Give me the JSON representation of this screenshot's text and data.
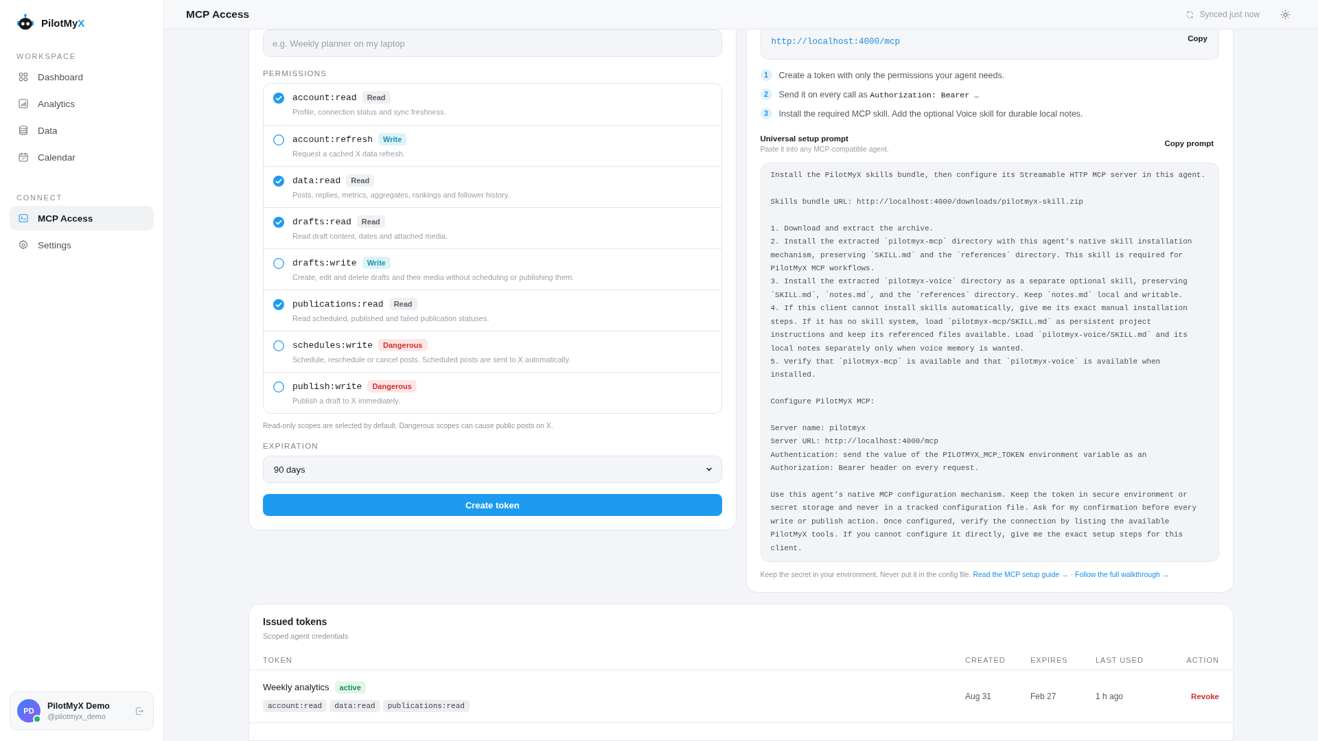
{
  "sidebar": {
    "brand": {
      "name": "PilotMy",
      "accent": "X"
    },
    "sections": [
      {
        "heading": "WORKSPACE",
        "items": [
          {
            "label": "Dashboard",
            "kind": "grid",
            "selected": false
          },
          {
            "label": "Analytics",
            "kind": "chart",
            "selected": false
          },
          {
            "label": "Data",
            "kind": "database",
            "selected": false
          },
          {
            "label": "Calendar",
            "kind": "calendar",
            "selected": false
          }
        ]
      },
      {
        "heading": "CONNECT",
        "items": [
          {
            "label": "MCP Access",
            "kind": "terminal",
            "selected": true
          },
          {
            "label": "Settings",
            "kind": "gear",
            "selected": false
          }
        ]
      }
    ],
    "user": {
      "initials": "PD",
      "name": "PilotMyX Demo",
      "handle": "@pilotmyx_demo",
      "online": true
    }
  },
  "header": {
    "title": "MCP Access",
    "sync_status": "Synced just now"
  },
  "token_form": {
    "name_field": {
      "placeholder": "e.g. Weekly planner on my laptop"
    },
    "permissions_heading": "PERMISSIONS",
    "permissions": [
      {
        "scope": "account:read",
        "badge": "Read",
        "kind": "read",
        "description": "Profile, connection status and sync freshness.",
        "checked": true
      },
      {
        "scope": "account:refresh",
        "badge": "Write",
        "kind": "write",
        "description": "Request a cached X data refresh.",
        "checked": false
      },
      {
        "scope": "data:read",
        "badge": "Read",
        "kind": "read",
        "description": "Posts, replies, metrics, aggregates, rankings and follower history.",
        "checked": true
      },
      {
        "scope": "drafts:read",
        "badge": "Read",
        "kind": "read",
        "description": "Read draft content, dates and attached media.",
        "checked": true
      },
      {
        "scope": "drafts:write",
        "badge": "Write",
        "kind": "write",
        "description": "Create, edit and delete drafts and their media without scheduling or publishing them.",
        "checked": false
      },
      {
        "scope": "publications:read",
        "badge": "Read",
        "kind": "read",
        "description": "Read scheduled, published and failed publication statuses.",
        "checked": true
      },
      {
        "scope": "schedules:write",
        "badge": "Dangerous",
        "kind": "danger",
        "description": "Schedule, reschedule or cancel posts. Scheduled posts are sent to X automatically.",
        "checked": false
      },
      {
        "scope": "publish:write",
        "badge": "Dangerous",
        "kind": "danger",
        "description": "Publish a draft to X immediately.",
        "checked": false
      }
    ],
    "note": "Read-only scopes are selected by default. Dangerous scopes can cause public posts on X.",
    "expiration_heading": "EXPIRATION",
    "expiration": {
      "value": "90 days"
    },
    "submit": "Create token"
  },
  "setup": {
    "url": "http://localhost:4000/mcp",
    "copy": "Copy",
    "steps": [
      {
        "number": "1",
        "text": "Create a token with only the permissions your agent needs."
      },
      {
        "number": "2",
        "text": "Send it on every call as",
        "code": "Authorization: Bearer …"
      },
      {
        "number": "3",
        "text": "Install the required MCP skill. Add the optional Voice skill for durable local notes."
      }
    ],
    "prompt_title": "Universal setup prompt",
    "prompt_subtitle": "Paste it into any MCP-compatible agent.",
    "copy_prompt": "Copy prompt",
    "prompt": "Install the PilotMyX skills bundle, then configure its Streamable HTTP MCP server in this agent.\n\nSkills bundle URL: http://localhost:4000/downloads/pilotmyx-skill.zip\n\n1. Download and extract the archive.\n2. Install the extracted `pilotmyx-mcp` directory with this agent's native skill installation mechanism, preserving `SKILL.md` and the `references` directory. This skill is required for PilotMyX MCP workflows.\n3. Install the extracted `pilotmyx-voice` directory as a separate optional skill, preserving `SKILL.md`, `notes.md`, and the `references` directory. Keep `notes.md` local and writable.\n4. If this client cannot install skills automatically, give me its exact manual installation steps. If it has no skill system, load `pilotmyx-mcp/SKILL.md` as persistent project instructions and keep its referenced files available. Load `pilotmyx-voice/SKILL.md` and its local notes separately only when voice memory is wanted.\n5. Verify that `pilotmyx-mcp` is available and that `pilotmyx-voice` is available when installed.\n\nConfigure PilotMyX MCP:\n\nServer name: pilotmyx\nServer URL: http://localhost:4000/mcp\nAuthentication: send the value of the PILOTMYX_MCP_TOKEN environment variable as an Authorization: Bearer header on every request.\n\nUse this agent's native MCP configuration mechanism. Keep the token in secure environment or secret storage and never in a tracked configuration file. Ask for my confirmation before every write or publish action. Once configured, verify the connection by listing the available PilotMyX tools. If you cannot configure it directly, give me the exact setup steps for this client.",
    "footer_note": "Keep the secret in your environment. Never put it in the config file.",
    "links": [
      "Read the MCP setup guide →",
      "Follow the full walkthrough →"
    ],
    "link_separator": "·"
  },
  "tokens": {
    "title": "Issued tokens",
    "subtitle": "Scoped agent credentials",
    "columns": [
      "TOKEN",
      "CREATED",
      "EXPIRES",
      "LAST USED",
      "ACTION"
    ],
    "rows": [
      {
        "name": "Weekly analytics",
        "status": "active",
        "scopes": [
          "account:read",
          "data:read",
          "publications:read"
        ],
        "created": "Aug 31",
        "expires": "Feb 27",
        "last_used": "1 h ago",
        "action": "Revoke"
      }
    ]
  }
}
